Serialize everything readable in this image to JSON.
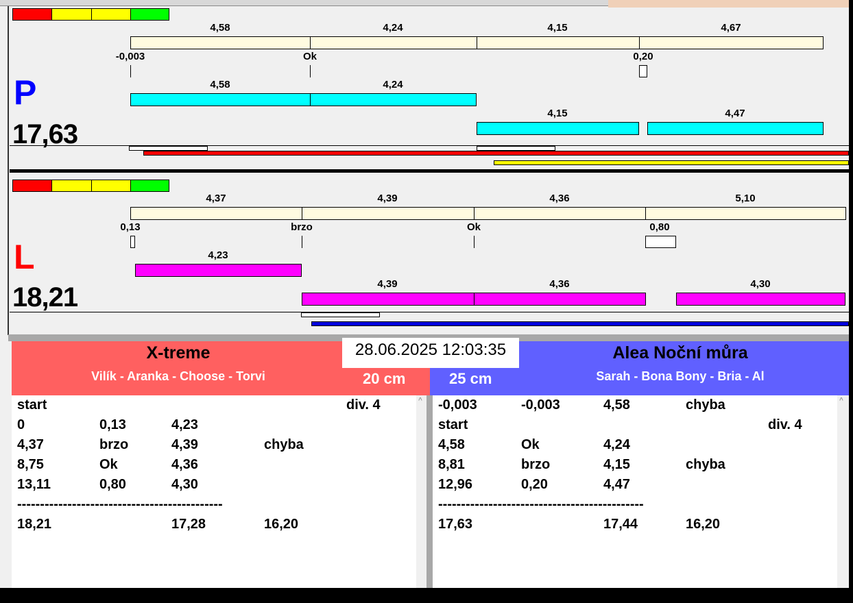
{
  "colors": {
    "danger": "#ff0000",
    "warn": "#ffff00",
    "ok": "#00ff00",
    "p_bars": "#00ffff",
    "l_bars": "#ff00ff",
    "left_team": "#ff6060",
    "right_team": "#6060ff"
  },
  "P": {
    "letter": "P",
    "total": "17,63",
    "top": [
      "4,58",
      "4,24",
      "4,15",
      "4,67"
    ],
    "markers": [
      "-0,003",
      "Ok",
      "0,20"
    ],
    "row1": [
      "4,58",
      "4,24"
    ],
    "row2": [
      "4,15",
      "4,47"
    ]
  },
  "L": {
    "letter": "L",
    "total": "18,21",
    "top": [
      "4,37",
      "4,39",
      "4,36",
      "5,10"
    ],
    "markers": [
      "0,13",
      "brzo",
      "Ok",
      "0,80"
    ],
    "row1": [
      "4,23"
    ],
    "row2": [
      "4,39",
      "4,36",
      "4,30"
    ]
  },
  "timestamp": "28.06.2025 12:03:35",
  "left_team": {
    "name": "X-treme",
    "dogs": "Vilík - Aranka - Choose - Torvi",
    "height": "20 cm",
    "rows": [
      [
        "start",
        "",
        "",
        "",
        "div.  4"
      ],
      [
        "0",
        "0,13",
        "4,23",
        "",
        ""
      ],
      [
        "4,37",
        "brzo",
        "4,39",
        "chyba",
        ""
      ],
      [
        "8,75",
        "Ok",
        "4,36",
        "",
        ""
      ],
      [
        "13,11",
        "0,80",
        "4,30",
        "",
        ""
      ],
      [
        "---------------------------------------------",
        "",
        "",
        "",
        ""
      ],
      [
        "18,21",
        "",
        "17,28",
        "16,20",
        ""
      ]
    ]
  },
  "right_team": {
    "name": "Alea Noční můra",
    "dogs": "Sarah - Bona Bony - Bria - Al",
    "height": "25 cm",
    "rows": [
      [
        "-0,003",
        "-0,003",
        "4,58",
        "chyba",
        ""
      ],
      [
        "start",
        "",
        "",
        "",
        "div.  4"
      ],
      [
        "4,58",
        "Ok",
        "4,24",
        "",
        ""
      ],
      [
        "8,81",
        "brzo",
        "4,15",
        "chyba",
        ""
      ],
      [
        "12,96",
        "0,20",
        "4,47",
        "",
        ""
      ],
      [
        "---------------------------------------------",
        "",
        "",
        "",
        ""
      ],
      [
        "17,63",
        "",
        "17,44",
        "16,20",
        ""
      ]
    ]
  }
}
